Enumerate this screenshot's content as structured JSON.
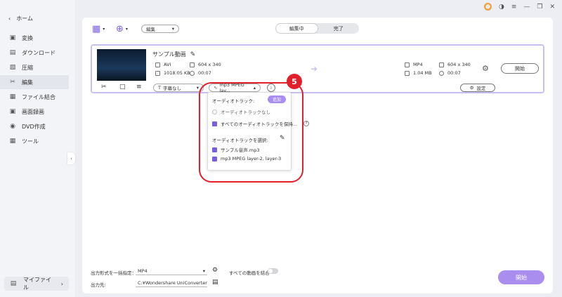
{
  "sidebar": {
    "home": "ホーム",
    "items": [
      {
        "label": "変換",
        "icon": "convert-icon"
      },
      {
        "label": "ダウンロード",
        "icon": "download-icon"
      },
      {
        "label": "圧縮",
        "icon": "compress-icon"
      },
      {
        "label": "編集",
        "icon": "edit-icon",
        "active": true
      },
      {
        "label": "ファイル結合",
        "icon": "merge-icon"
      },
      {
        "label": "画面録画",
        "icon": "screen-record-icon"
      },
      {
        "label": "DVD作成",
        "icon": "dvd-icon"
      },
      {
        "label": "ツール",
        "icon": "tools-icon"
      }
    ],
    "my_files": "マイファイル"
  },
  "toolbar": {
    "dropdown_value": "編集",
    "segments": [
      "編集中",
      "完了"
    ]
  },
  "file": {
    "title": "サンプル動画",
    "source": {
      "format": "AVI",
      "resolution": "604 x 340",
      "size": "1018.05 KB",
      "duration": "00:07"
    },
    "target": {
      "format": "MP4",
      "resolution": "604 x 340",
      "size": "1.04 MB",
      "duration": "00:07"
    },
    "start_label": "開始",
    "subtitle_value": "字幕なし",
    "audio_value": "mp3 MPEG lay...",
    "settings_label": "設定"
  },
  "popup": {
    "header": "オーディオトラック:",
    "add_label": "追加",
    "opt_none": "オーディオトラックなし",
    "opt_keep_all": "すべてのオーディオトラックを保持...",
    "select_label": "オーディオトラックを選択:",
    "tracks": [
      "サンプル音声.mp3",
      "mp3 MPEG layer-2, layer-3"
    ]
  },
  "annotation": {
    "step": "5",
    "color": "#e0202a"
  },
  "footer": {
    "format_label": "出力形式を一括指定：",
    "format_value": "MP4",
    "merge_label": "すべての動画を結合",
    "dest_label": "出力先:",
    "dest_value": "C:¥Wondershare UniConverter 1",
    "start_label": "開始"
  },
  "colors": {
    "accent": "#a98ef0",
    "card_border": "#c6c0f2"
  }
}
